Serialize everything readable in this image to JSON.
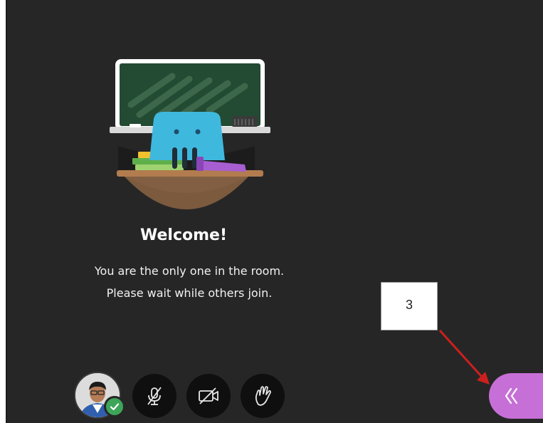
{
  "welcome": {
    "title": "Welcome!",
    "line1": "You are the only one in the room.",
    "line2": "Please wait while others join."
  },
  "annotation": {
    "number": "3"
  },
  "controls": {
    "avatar_status": "check-icon",
    "mic": "microphone-off-icon",
    "camera": "camera-off-icon",
    "hand": "raise-hand-icon"
  },
  "panel_toggle": {
    "icon": "double-chevron-left-icon"
  },
  "colors": {
    "background": "#262626",
    "accent": "#c66fd6",
    "status_green": "#3da55a",
    "annotation_arrow": "#cc1f1f"
  }
}
